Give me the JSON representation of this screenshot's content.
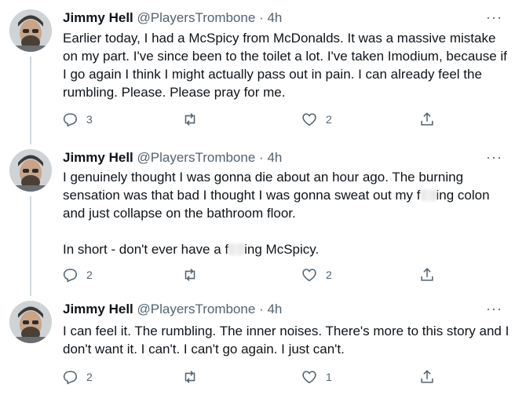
{
  "tweets": [
    {
      "author_name": "Jimmy Hell",
      "author_handle": "@PlayersTrombone",
      "separator": "·",
      "time": "4h",
      "more": "···",
      "paragraphs": [
        "Earlier today, I had a McSpicy from McDonalds. It was a massive mistake on my part. I've since been to the toilet a lot. I've taken Imodium, because if I go again I think I might actually pass out in pain. I can already feel the rumbling. Please. Please pray for me."
      ],
      "replies": "3",
      "retweets": "",
      "likes": "2"
    },
    {
      "author_name": "Jimmy Hell",
      "author_handle": "@PlayersTrombone",
      "separator": "·",
      "time": "4h",
      "more": "···",
      "p1_before": "I genuinely thought I was gonna die about an hour ago. The burning sensation was that bad I thought I was gonna sweat out my f",
      "p1_after": "ing colon and just collapse on the bathroom floor.",
      "p2_before": "In short - don't ever have a f",
      "p2_after": "ing McSpicy.",
      "replies": "2",
      "retweets": "",
      "likes": "2"
    },
    {
      "author_name": "Jimmy Hell",
      "author_handle": "@PlayersTrombone",
      "separator": "·",
      "time": "4h",
      "more": "···",
      "paragraphs": [
        "I can feel it. The rumbling. The inner noises. There's more to this story and I don't want it. I can't. I can't go again. I just can't."
      ],
      "replies": "2",
      "retweets": "",
      "likes": "1"
    }
  ],
  "icons": {
    "reply": "reply-icon",
    "retweet": "retweet-icon",
    "like": "like-icon",
    "share": "share-icon",
    "more": "more-icon"
  },
  "colors": {
    "text": "#0f1419",
    "secondary": "#536471",
    "thread_line": "#cfd9de",
    "divider": "#eff3f4"
  }
}
